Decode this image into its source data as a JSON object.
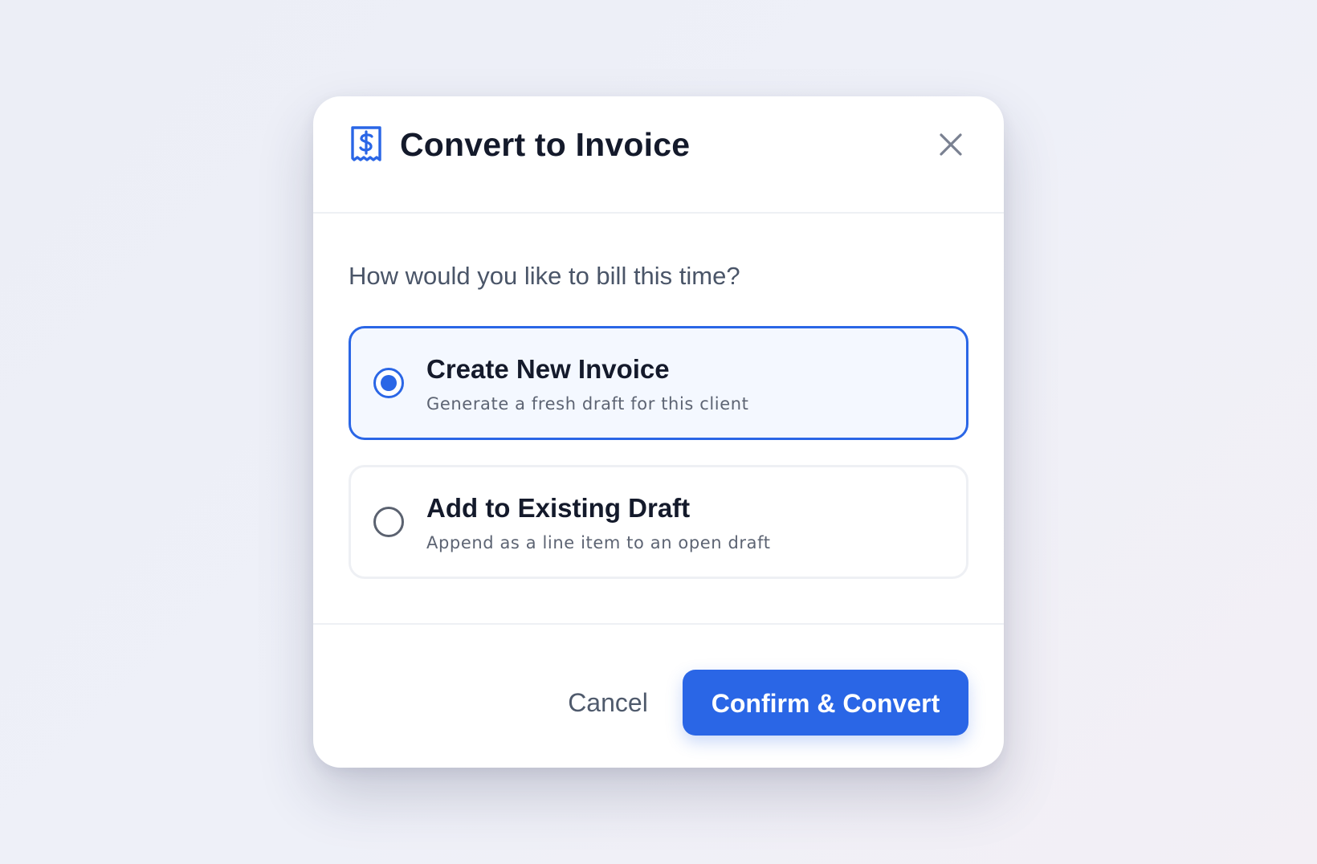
{
  "colors": {
    "accent": "#2a66e6",
    "title": "#141a2b",
    "muted": "#4a5568",
    "border": "#eef0f4"
  },
  "dialog": {
    "title": "Convert to Invoice",
    "title_icon": "invoice-dollar-icon",
    "close_icon": "close-icon",
    "prompt": "How would you like to bill this time?",
    "options": [
      {
        "label": "Create New Invoice",
        "description": "Generate a fresh draft for this client",
        "selected": true
      },
      {
        "label": "Add to Existing Draft",
        "description": "Append as a line item to an open draft",
        "selected": false
      }
    ],
    "cancel_label": "Cancel",
    "confirm_label": "Confirm & Convert"
  }
}
